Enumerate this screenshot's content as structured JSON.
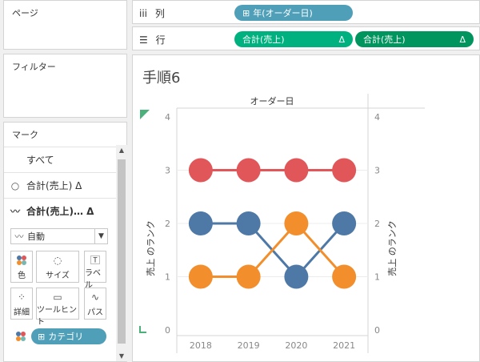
{
  "pages": {
    "title": "ページ"
  },
  "filters": {
    "title": "フィルター"
  },
  "marks": {
    "title": "マーク",
    "items": [
      {
        "label": "すべて",
        "icon": ""
      },
      {
        "label": "合計(売上) Δ",
        "icon": "circle-icon"
      },
      {
        "label": "合計(売上)… Δ",
        "icon": "line-icon"
      }
    ],
    "mark_type": "自動",
    "cards": [
      {
        "label": "色",
        "icon": "color-icon"
      },
      {
        "label": "サイズ",
        "icon": "size-icon"
      },
      {
        "label": "ラベル",
        "icon": "label-icon"
      },
      {
        "label": "詳細",
        "icon": "detail-icon"
      },
      {
        "label": "ツールヒント",
        "icon": "tooltip-icon"
      },
      {
        "label": "パス",
        "icon": "path-icon"
      }
    ],
    "color_pill": "カテゴリ"
  },
  "columns": {
    "label": "列",
    "icon": "columns-icon",
    "pill": "年(オーダー日)"
  },
  "rows": {
    "label": "行",
    "icon": "rows-icon",
    "pills": [
      "合計(売上)",
      "合計(売上)"
    ],
    "delta": "Δ"
  },
  "sheet": {
    "title": "手順6"
  },
  "chart_data": {
    "type": "line",
    "title": "オーダー日",
    "x": [
      "2018",
      "2019",
      "2020",
      "2021"
    ],
    "ylabel_left": "売上 のランク",
    "ylabel_right": "売上 のランク",
    "ylim": [
      0,
      4
    ],
    "yticks": [
      0,
      1,
      2,
      3,
      4
    ],
    "series": [
      {
        "color": "#e15759",
        "values": [
          3,
          3,
          3,
          3
        ]
      },
      {
        "color": "#4e79a7",
        "values": [
          2,
          2,
          1,
          2
        ]
      },
      {
        "color": "#f28e2b",
        "values": [
          1,
          1,
          2,
          1
        ]
      }
    ]
  },
  "colors": {
    "pill_dimension": "#4f9fb9",
    "pill_measure": "#00b180",
    "pill_measure_dark": "#00945f"
  }
}
